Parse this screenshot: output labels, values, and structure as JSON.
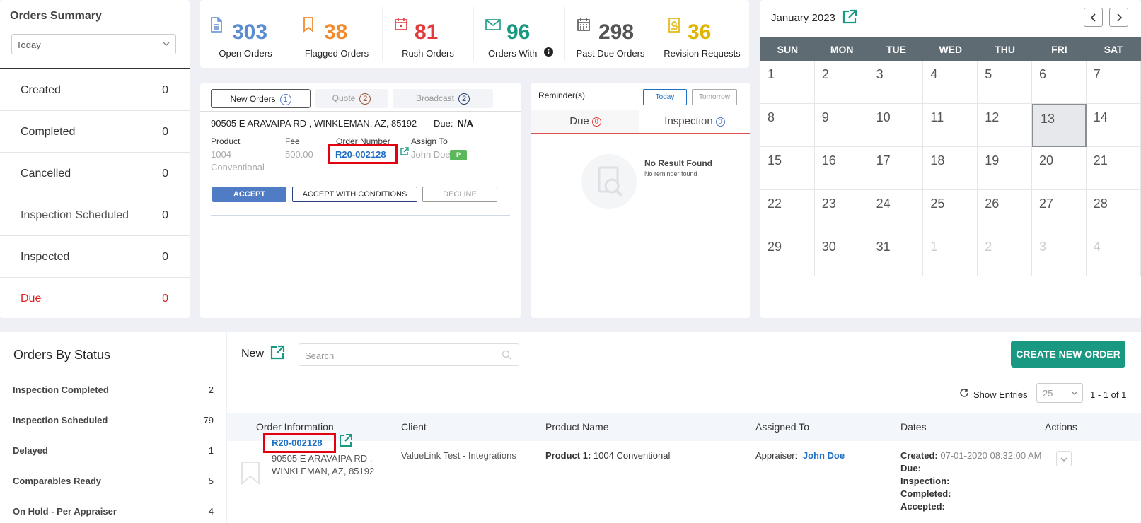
{
  "summary": {
    "title": "Orders Summary",
    "range": "Today",
    "rows": [
      {
        "label": "Created",
        "value": "0"
      },
      {
        "label": "Completed",
        "value": "0"
      },
      {
        "label": "Cancelled",
        "value": "0"
      },
      {
        "label": "Inspection Scheduled",
        "value": "0"
      },
      {
        "label": "Inspected",
        "value": "0"
      },
      {
        "label": "Due",
        "value": "0"
      }
    ]
  },
  "stats": [
    {
      "value": "303",
      "label": "Open Orders",
      "icon": "document-icon",
      "color": "#5b8bd0"
    },
    {
      "value": "38",
      "label": "Flagged Orders",
      "icon": "bookmark-icon",
      "color": "#f28a2e"
    },
    {
      "value": "81",
      "label": "Rush Orders",
      "icon": "calendar-alert-icon",
      "color": "#e03b3b"
    },
    {
      "value": "96",
      "label": "Orders With",
      "icon": "envelope-icon",
      "color": "#1a9982"
    },
    {
      "value": "298",
      "label": "Past Due Orders",
      "icon": "calendar-grid-icon",
      "color": "#555555"
    },
    {
      "value": "36",
      "label": "Revision Requests",
      "icon": "revision-icon",
      "color": "#e0b400"
    }
  ],
  "orders": {
    "tabs": [
      {
        "label": "New Orders",
        "count": "1"
      },
      {
        "label": "Quote",
        "count": "2"
      },
      {
        "label": "Broadcast",
        "count": "2"
      }
    ],
    "address": "90505 E ARAVAIPA RD , WINKLEMAN, AZ, 85192",
    "due_label": "Due:",
    "due_value": "N/A",
    "product_label": "Product",
    "product_line1": "1004",
    "product_line2": "Conventional",
    "fee_label": "Fee",
    "fee_value": "500.00",
    "order_number_label": "Order Number",
    "order_number": "R20-002128",
    "assign_label": "Assign To",
    "assign_value": "John Doe",
    "assign_badge": "P",
    "accept": "ACCEPT",
    "accept_conditions": "ACCEPT WITH CONDITIONS",
    "decline": "DECLINE"
  },
  "reminders": {
    "title": "Reminder(s)",
    "today": "Today",
    "tomorrow": "Tomorrow",
    "due_tab": "Due",
    "due_count": "0",
    "inspection_tab": "Inspection",
    "inspection_count": "0",
    "no_result": "No Result Found",
    "no_reminder": "No reminder found"
  },
  "calendar": {
    "month": "January 2023",
    "weekdays": [
      "SUN",
      "MON",
      "TUE",
      "WED",
      "THU",
      "FRI",
      "SAT"
    ],
    "days": [
      {
        "d": "1"
      },
      {
        "d": "2"
      },
      {
        "d": "3"
      },
      {
        "d": "4"
      },
      {
        "d": "5"
      },
      {
        "d": "6"
      },
      {
        "d": "7"
      },
      {
        "d": "8"
      },
      {
        "d": "9"
      },
      {
        "d": "10"
      },
      {
        "d": "11"
      },
      {
        "d": "12"
      },
      {
        "d": "13",
        "today": true
      },
      {
        "d": "14"
      },
      {
        "d": "15"
      },
      {
        "d": "16"
      },
      {
        "d": "17"
      },
      {
        "d": "18"
      },
      {
        "d": "19"
      },
      {
        "d": "20"
      },
      {
        "d": "21"
      },
      {
        "d": "22"
      },
      {
        "d": "23"
      },
      {
        "d": "24"
      },
      {
        "d": "25"
      },
      {
        "d": "26"
      },
      {
        "d": "27"
      },
      {
        "d": "28"
      },
      {
        "d": "29"
      },
      {
        "d": "30"
      },
      {
        "d": "31"
      },
      {
        "d": "1",
        "other": true
      },
      {
        "d": "2",
        "other": true
      },
      {
        "d": "3",
        "other": true
      },
      {
        "d": "4",
        "other": true
      }
    ]
  },
  "status": {
    "title": "Orders By Status",
    "rows": [
      {
        "label": "Inspection Completed",
        "value": "2"
      },
      {
        "label": "Inspection Scheduled",
        "value": "79"
      },
      {
        "label": "Delayed",
        "value": "1"
      },
      {
        "label": "Comparables Ready",
        "value": "5"
      },
      {
        "label": "On Hold - Per Appraiser",
        "value": "4"
      }
    ]
  },
  "table": {
    "new_label": "New",
    "search_placeholder": "Search",
    "create_button": "CREATE NEW ORDER",
    "show_entries": "Show Entries",
    "entries_value": "25",
    "range": "1 - 1 of 1",
    "columns": [
      "Order Information",
      "Client",
      "Product Name",
      "Assigned To",
      "Dates",
      "Actions"
    ],
    "row": {
      "order_number": "R20-002128",
      "address1": "90505 E ARAVAIPA RD ,",
      "address2": "WINKLEMAN, AZ, 85192",
      "client": "ValueLink Test - Integrations",
      "product_label": "Product 1:",
      "product_value": "1004 Conventional",
      "assigned_label": "Appraiser:",
      "assigned_value": "John Doe",
      "created_label": "Created:",
      "created_value": "07-01-2020 08:32:00 AM",
      "due_label": "Due:",
      "inspection_label": "Inspection:",
      "completed_label": "Completed:",
      "accepted_label": "Accepted:"
    }
  }
}
